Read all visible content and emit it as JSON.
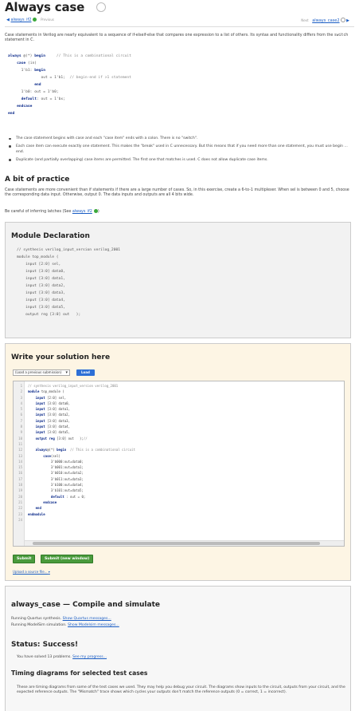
{
  "header": {
    "title": "Always case",
    "prev_link": "always_if2",
    "prev_label": "Previous",
    "next_label": "Next",
    "next_link": "always_case2"
  },
  "intro": {
    "text_before": "Case statements in Verilog are nearly equivalent to a sequence of if-elseif-else that compares one expression to a list of others. Its syntax and functionality differs from the ",
    "code_word": "switch",
    "text_after": " statement in C."
  },
  "example_code": [
    "always @(*) begin     // This is a combinational circuit",
    "    case (in)",
    "      1'b1: begin",
    "               out = 1'b1;  // begin-end if >1 statement",
    "            end",
    "      1'b0: out = 1'b0;",
    "      default: out = 1'bx;",
    "    endcase",
    "end"
  ],
  "bullets": [
    "The case statement begins with case and each \"case item\" ends with a colon. There is no \"switch\".",
    "Each case item can execute exactly one statement. This makes the \"break\" used in C unnecessary. But this means that if you need more than one statement, you must use begin ... end.",
    "Duplicate (and partially overlapping) case items are permitted. The first one that matches is used. C does not allow duplicate case items."
  ],
  "practice": {
    "heading": "A bit of practice",
    "text": "Case statements are more convenient than if statements if there are a large number of cases. So, in this exercise, create a 6-to-1 multiplexer. When sel is between 0 and 5, choose the corresponding data input. Otherwise, output 0. The data inputs and outputs are all 4 bits wide.",
    "careful_prefix": "Be careful of inferring latches (See ",
    "careful_link": "always_if2",
    "careful_suffix": ")"
  },
  "module_decl": {
    "title": "Module Declaration",
    "code": [
      "// synthesis verilog_input_version verilog_2001",
      "module top_module (",
      "    input [2:0] sel,",
      "    input [3:0] data0,",
      "    input [3:0] data1,",
      "    input [3:0] data2,",
      "    input [3:0] data3,",
      "    input [3:0] data4,",
      "    input [3:0] data5,",
      "    output reg [3:0] out   );"
    ]
  },
  "solution": {
    "title": "Write your solution here",
    "load_select": "(Load a previous submission)",
    "load_button": "Load",
    "line_numbers": [
      "1",
      "2",
      "3",
      "4",
      "5",
      "6",
      "7",
      "8",
      "9",
      "10",
      "11",
      "12",
      "13",
      "14",
      "15",
      "16",
      "17",
      "18",
      "19",
      "20",
      "21",
      "22",
      "23",
      "24"
    ],
    "code": [
      "// synthesis verilog_input_version verilog_2001",
      "module top_module (",
      "    input [2:0] sel,",
      "    input [3:0] data0,",
      "    input [3:0] data1,",
      "    input [3:0] data2,",
      "    input [3:0] data3,",
      "    input [3:0] data4,",
      "    input [3:0] data5,",
      "    output reg [3:0] out   );//",
      "",
      "    always@(*) begin  // This is a combinational circuit",
      "        case(sel)",
      "            3'b000:out=data0;",
      "            3'b001:out=data1;",
      "            3'b010:out=data2;",
      "            3'b011:out=data3;",
      "            3'b100:out=data4;",
      "            3'b101:out=data5;",
      "            default : out = 0;",
      "        endcase",
      "    end",
      "endmodule",
      ""
    ],
    "submit": "Submit",
    "submit_new": "Submit (new window)",
    "upload": "Upload a source file..."
  },
  "results": {
    "title": "always_case — Compile and simulate",
    "quartus_prefix": "Running Quartus synthesis. ",
    "quartus_link": "Show Quartus messages...",
    "modelsim_prefix": "Running ModelSim simulation. ",
    "modelsim_link": "Show Modelsim messages...",
    "status": "Status: Success!",
    "solved_prefix": "You have solved 13 problems. ",
    "solved_link": "See my progress...",
    "timing_title": "Timing diagrams for selected test cases",
    "timing_text": "These are timing diagrams from some of the test cases we used. They may help you debug your circuit. The diagrams show inputs to the circuit, outputs from your circuit, and the expected reference outputs. The \"Mismatch\" trace shows which cycles your outputs don't match the reference outputs (0 = correct, 1 = incorrect)."
  }
}
